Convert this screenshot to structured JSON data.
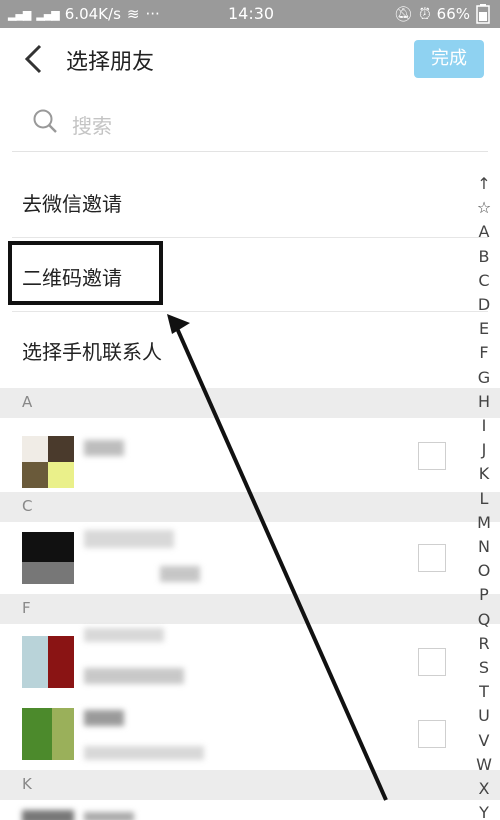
{
  "status_bar": {
    "left_text": "6.04K/s",
    "dots": "···",
    "time": "14:30",
    "battery": "66%"
  },
  "header": {
    "title": "选择朋友",
    "done_label": "完成"
  },
  "search": {
    "placeholder": "搜索"
  },
  "options": [
    {
      "label": "去微信邀请"
    },
    {
      "label": "二维码邀请"
    },
    {
      "label": "选择手机联系人"
    }
  ],
  "sections": [
    {
      "letter": "A"
    },
    {
      "letter": "C"
    },
    {
      "letter": "F"
    },
    {
      "letter": "K"
    }
  ],
  "index_letters": [
    "↑",
    "☆",
    "A",
    "B",
    "C",
    "D",
    "E",
    "F",
    "G",
    "H",
    "I",
    "J",
    "K",
    "L",
    "M",
    "N",
    "O",
    "P",
    "Q",
    "R",
    "S",
    "T",
    "U",
    "V",
    "W",
    "X",
    "Y"
  ],
  "colors": {
    "done_button": "#8fd2f1",
    "status_bar": "#9a9a9a",
    "section_bg": "#ececec"
  }
}
